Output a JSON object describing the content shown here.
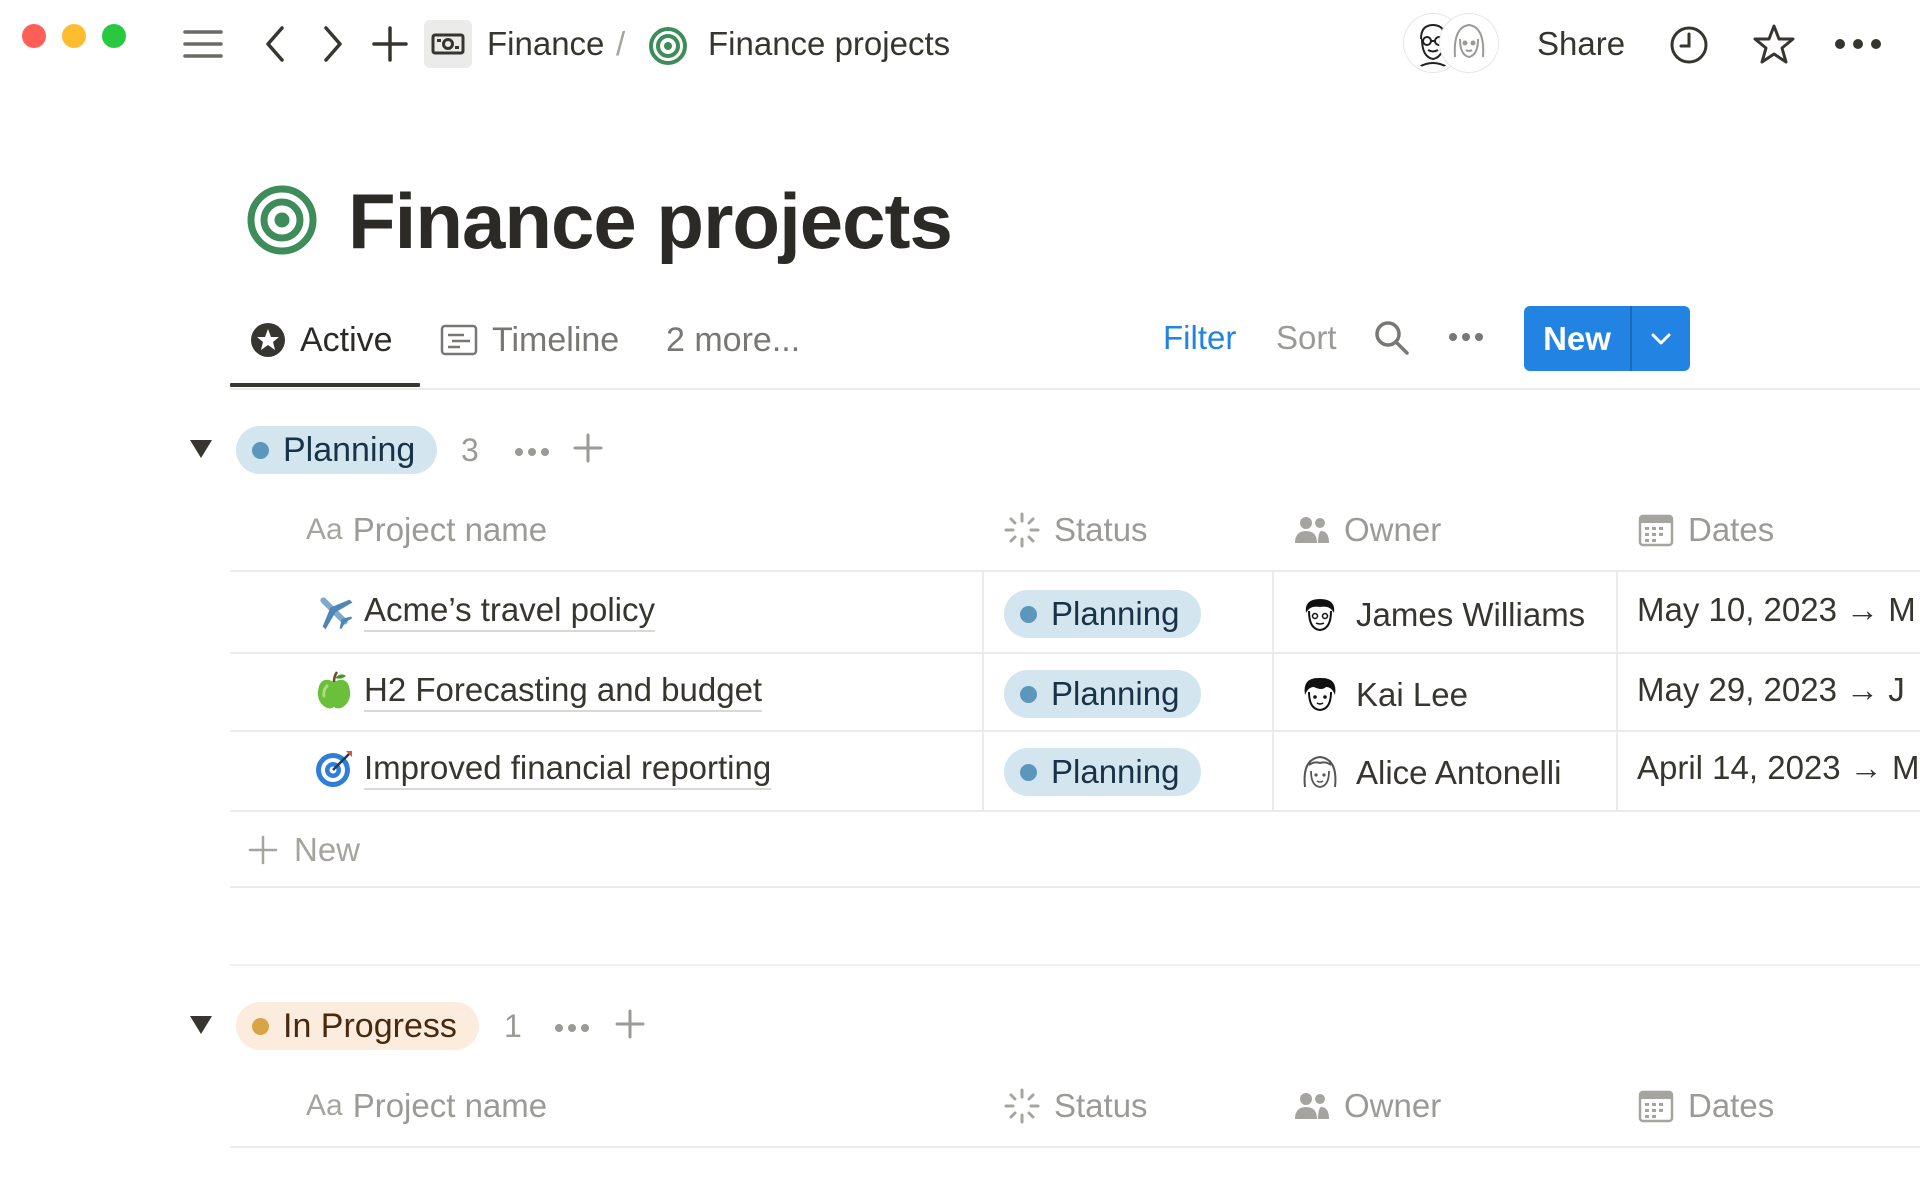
{
  "topbar": {
    "breadcrumb_parent": "Finance",
    "breadcrumb_separator": "/",
    "breadcrumb_current": "Finance projects",
    "share_label": "Share",
    "icons": [
      "menu-icon",
      "back-icon",
      "forward-icon",
      "plus-icon",
      "money-icon",
      "target-icon",
      "clock-icon",
      "star-icon",
      "more-icon"
    ]
  },
  "page": {
    "title": "Finance projects",
    "icon": "target-icon"
  },
  "views": {
    "tabs": [
      {
        "label": "Active",
        "icon": "star-badge-icon",
        "active": true
      },
      {
        "label": "Timeline",
        "icon": "timeline-icon",
        "active": false
      },
      {
        "label": "2 more...",
        "active": false
      }
    ],
    "filter_label": "Filter",
    "sort_label": "Sort",
    "new_label": "New"
  },
  "columns": {
    "name": "Project name",
    "name_prefix": "Aa",
    "status": "Status",
    "owner": "Owner",
    "dates": "Dates"
  },
  "groups": [
    {
      "label": "Planning",
      "count": "3",
      "rows": [
        {
          "name": "Acme’s travel policy",
          "emoji": "airplane-icon",
          "status": "Planning",
          "owner": "James Williams",
          "dates": "May 10, 2023 → M"
        },
        {
          "name": "H2 Forecasting and budget",
          "emoji": "apple-icon",
          "status": "Planning",
          "owner": "Kai Lee",
          "dates": "May 29, 2023 → J"
        },
        {
          "name": "Improved financial reporting",
          "emoji": "dart-icon",
          "status": "Planning",
          "owner": "Alice Antonelli",
          "dates": "April 14, 2023 → M"
        }
      ],
      "new_label": "New"
    },
    {
      "label": "In Progress",
      "count": "1",
      "rows": []
    }
  ],
  "colors": {
    "accent": "#2383e2",
    "planning_bg": "#d3e5ef",
    "planning_dot": "#5b97bd",
    "progress_bg": "#fbecdd",
    "progress_dot": "#d9a445",
    "target_green": "#3d8c5a"
  }
}
